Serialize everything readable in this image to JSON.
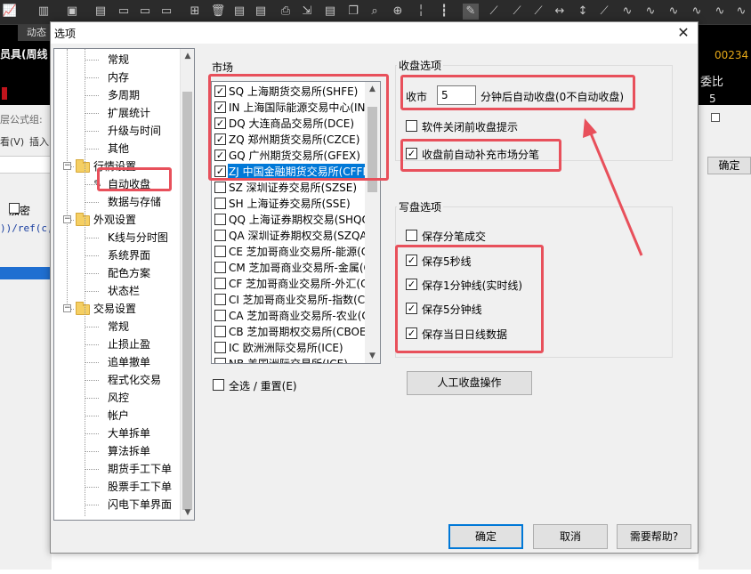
{
  "background": {
    "tab_label": "动态",
    "left_title": "员具(周线",
    "formula_label": "层公式组:",
    "menu_v": "看(V)",
    "menu_insert": "插入",
    "encrypt_label": "加密",
    "code_text": "))/ref(c,",
    "right_number": "00234",
    "right_wei": "委比",
    "right_five": "5",
    "right_ok": "确定"
  },
  "dialog": {
    "title": "选项",
    "close_glyph": "✕"
  },
  "tree": {
    "items": [
      {
        "label": "常规",
        "level": 2
      },
      {
        "label": "内存",
        "level": 2
      },
      {
        "label": "多周期",
        "level": 2
      },
      {
        "label": "扩展统计",
        "level": 2
      },
      {
        "label": "升级与时间",
        "level": 2
      },
      {
        "label": "其他",
        "level": 2
      },
      {
        "label": "行情设置",
        "level": 1
      },
      {
        "label": "自动收盘",
        "level": 2,
        "selected": true
      },
      {
        "label": "数据与存储",
        "level": 2
      },
      {
        "label": "外观设置",
        "level": 1
      },
      {
        "label": "K线与分时图",
        "level": 2
      },
      {
        "label": "系统界面",
        "level": 2
      },
      {
        "label": "配色方案",
        "level": 2
      },
      {
        "label": "状态栏",
        "level": 2
      },
      {
        "label": "交易设置",
        "level": 1
      },
      {
        "label": "常规",
        "level": 2
      },
      {
        "label": "止损止盈",
        "level": 2
      },
      {
        "label": "追单撤单",
        "level": 2
      },
      {
        "label": "程式化交易",
        "level": 2
      },
      {
        "label": "风控",
        "level": 2
      },
      {
        "label": "帐户",
        "level": 2
      },
      {
        "label": "大单拆单",
        "level": 2
      },
      {
        "label": "算法拆单",
        "level": 2
      },
      {
        "label": "期货手工下单",
        "level": 2
      },
      {
        "label": "股票手工下单",
        "level": 2
      },
      {
        "label": "闪电下单界面",
        "level": 2
      }
    ]
  },
  "market": {
    "title": "市场",
    "items": [
      {
        "label": "SQ 上海期货交易所(SHFE)",
        "checked": true
      },
      {
        "label": "IN 上海国际能源交易中心(INE)",
        "checked": true
      },
      {
        "label": "DQ 大连商品交易所(DCE)",
        "checked": true
      },
      {
        "label": "ZQ 郑州期货交易所(CZCE)",
        "checked": true
      },
      {
        "label": "GQ 广州期货交易所(GFEX)",
        "checked": true
      },
      {
        "label": "ZJ 中国金融期货交易所(CFFEX)",
        "checked": true,
        "selected": true
      },
      {
        "label": "SZ 深圳证券交易所(SZSE)",
        "checked": false
      },
      {
        "label": "SH 上海证券交易所(SSE)",
        "checked": false
      },
      {
        "label": "QQ 上海证券期权交易(SHQQ)",
        "checked": false
      },
      {
        "label": "QA 深圳证券期权交易(SZQA)",
        "checked": false
      },
      {
        "label": "CE 芝加哥商业交易所-能源(CME)",
        "checked": false
      },
      {
        "label": "CM 芝加哥商业交易所-金属(CME)",
        "checked": false
      },
      {
        "label": "CF 芝加哥商业交易所-外汇(CME)",
        "checked": false
      },
      {
        "label": "CI 芝加哥商业交易所-指数(CME)",
        "checked": false
      },
      {
        "label": "CA 芝加哥商业交易所-农业(CME)",
        "checked": false
      },
      {
        "label": "CB 芝加哥期权交易所(CBOE)",
        "checked": false
      },
      {
        "label": "IC 欧洲洲际交易所(ICE)",
        "checked": false
      },
      {
        "label": "NB 美国洲际交易所(ICE)",
        "checked": false
      }
    ],
    "select_all_label": "全选 / 重置(E)"
  },
  "close_options": {
    "title": "收盘选项",
    "close_label": "收市",
    "minutes_value": "5",
    "after_label": "分钟后自动收盘(0不自动收盘)",
    "prompt_label": "软件关闭前收盘提示",
    "prompt_checked": false,
    "supplement_label": "收盘前自动补充市场分笔",
    "supplement_checked": true
  },
  "write_options": {
    "title": "写盘选项",
    "items": [
      {
        "label": "保存分笔成交",
        "checked": false
      },
      {
        "label": "保存5秒线",
        "checked": true
      },
      {
        "label": "保存1分钟线(实时线)",
        "checked": true
      },
      {
        "label": "保存5分钟线",
        "checked": true
      },
      {
        "label": "保存当日日线数据",
        "checked": true
      }
    ],
    "manual_button": "人工收盘操作"
  },
  "footer": {
    "ok": "确定",
    "cancel": "取消",
    "help": "需要帮助?"
  },
  "colors": {
    "highlight": "#e8505b",
    "selection": "#0078d7"
  }
}
